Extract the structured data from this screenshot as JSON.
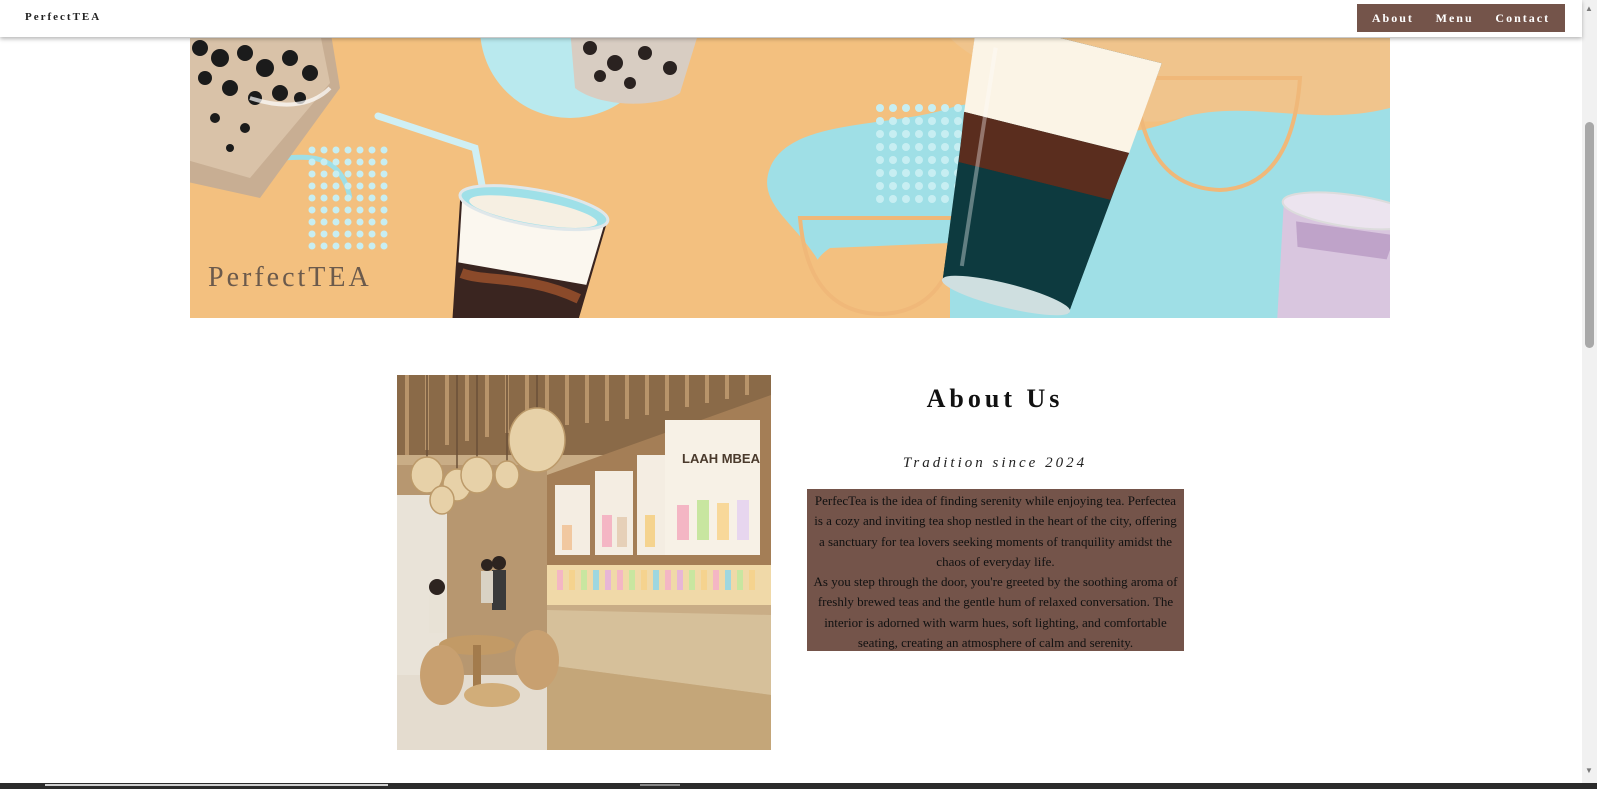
{
  "navbar": {
    "brand": "PerfectTEA",
    "links": [
      "About",
      "Menu",
      "Contact"
    ]
  },
  "hero": {
    "title": "PerfectTEA"
  },
  "about": {
    "heading": "About Us",
    "subheading": "Tradition since 2024",
    "paragraph_1": "PerfecTea is the idea of finding serenity while enjoying tea. Perfectea is a cozy and inviting tea shop nestled in the heart of the city, offering a sanctuary for tea lovers seeking moments of tranquility amidst the chaos of everyday life.",
    "paragraph_2": "As you step through the door, you're greeted by the soothing aroma of freshly brewed teas and the gentle hum of relaxed conversation. The interior is adorned with warm hues, soft lighting, and comfortable seating, creating an atmosphere of calm and serenity.",
    "image_sign": "LAAH MBEA"
  },
  "colors": {
    "accent": "#74544a",
    "hero_orange": "#f3c07f",
    "hero_blue": "#9fdfe6"
  }
}
